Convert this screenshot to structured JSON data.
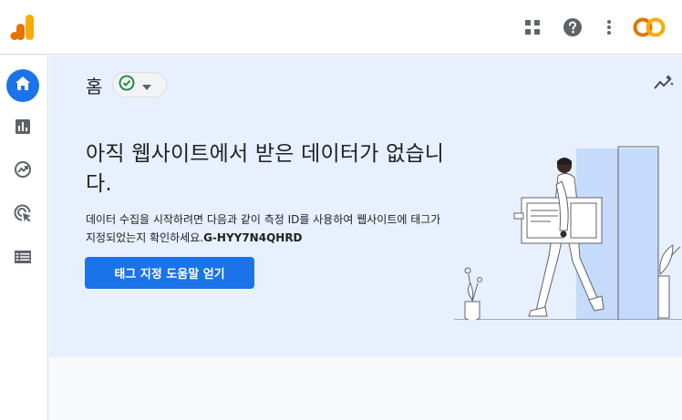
{
  "header": {
    "logo_icon": "analytics-logo",
    "apps_icon": "apps-grid-icon",
    "help_icon": "help-icon",
    "more_icon": "more-vert-icon",
    "account_avatar_text": "CO"
  },
  "sidebar": {
    "items": [
      {
        "name": "home",
        "icon": "home-icon",
        "active": true
      },
      {
        "name": "reports",
        "icon": "bar-chart-icon",
        "active": false
      },
      {
        "name": "explore",
        "icon": "explore-trend-icon",
        "active": false
      },
      {
        "name": "advertising",
        "icon": "target-cursor-icon",
        "active": false
      },
      {
        "name": "configure",
        "icon": "list-icon",
        "active": false
      }
    ]
  },
  "main": {
    "title": "홈",
    "status_icon": "check-circle-icon",
    "headline": "아직 웹사이트에서 받은 데이터가 없습니다.",
    "description_prefix": "데이터 수집을 시작하려면 다음과 같이 측정 ID를 사용하여 웹사이트에 태그가 지정되었는지 확인하세요.",
    "measurement_id": "G-HYY7N4QHRD",
    "cta_label": "태그 지정 도움말 얻기"
  },
  "colors": {
    "accent": "#1a73e8",
    "hero_bg": "#e8f0fe",
    "logo_orange": "#f9ab00",
    "logo_dark_orange": "#e37400",
    "status_green": "#188038"
  }
}
